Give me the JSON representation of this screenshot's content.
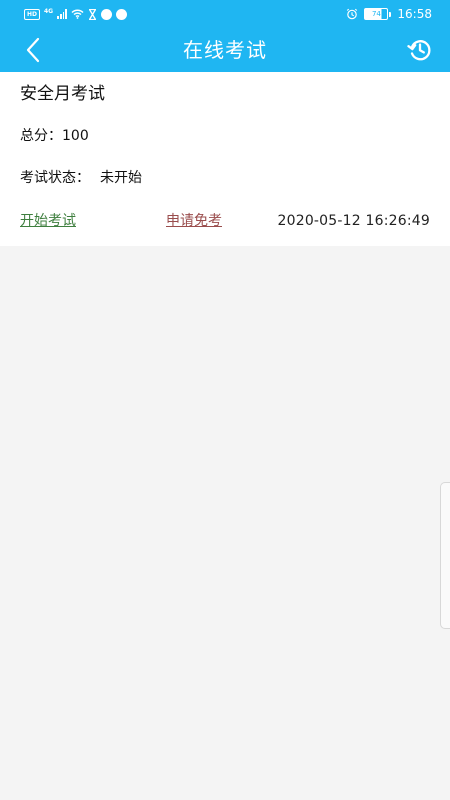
{
  "status_bar": {
    "network_badge": "HD",
    "network_type": "4G",
    "battery": "74",
    "time": "16:58"
  },
  "nav": {
    "title": "在线考试"
  },
  "exam": {
    "name": "安全月考试",
    "score_label": "总分：",
    "score_value": "100",
    "status_label": "考试状态：",
    "status_value": "未开始",
    "start_label": "开始考试",
    "exempt_label": "申请免考",
    "datetime": "2020-05-12 16:26:49"
  },
  "colors": {
    "header": "#1fb6f2",
    "background": "#f4f4f4",
    "start_link": "#3f7f3f",
    "exempt_link": "#9a4d4d"
  }
}
